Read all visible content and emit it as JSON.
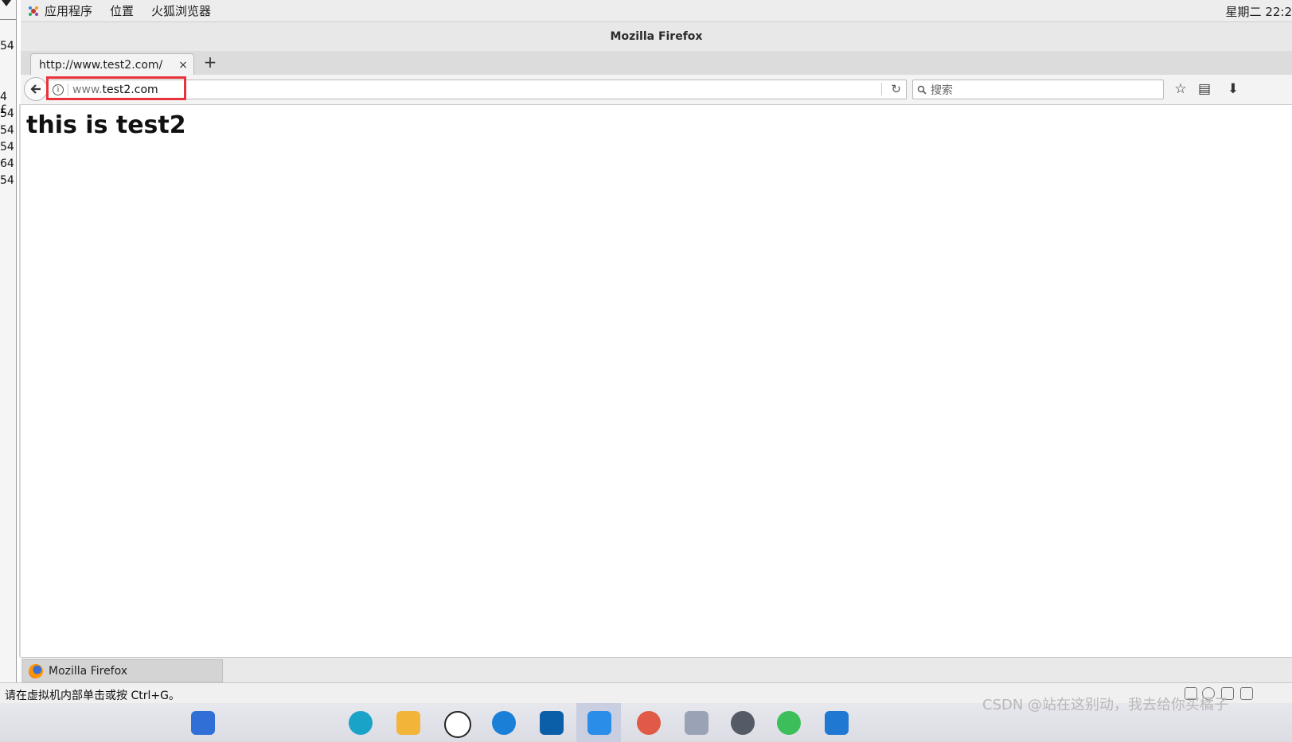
{
  "host_strip": {
    "numbers": [
      "54",
      "4 £",
      "54",
      "54",
      "54",
      "64",
      "54"
    ]
  },
  "gnome_topbar": {
    "menu": [
      "应用程序",
      "位置",
      "火狐浏览器"
    ],
    "clock": "星期二 22:2"
  },
  "window": {
    "title": "Mozilla Firefox"
  },
  "tabs": [
    {
      "title": "http://www.test2.com/",
      "close": "×"
    }
  ],
  "new_tab_label": "+",
  "urlbar": {
    "url_prefix": "www.",
    "url_domain": "test2.com"
  },
  "searchbar": {
    "placeholder": "搜索"
  },
  "page": {
    "heading": "this is test2"
  },
  "window_list": {
    "item": "Mozilla Firefox"
  },
  "vm_status": {
    "hint": "请在虚拟机内部单击或按 Ctrl+G。"
  },
  "watermark": "CSDN @站在这别动，我去给你买橘子",
  "colors": {
    "highlight": "#e8333a"
  }
}
